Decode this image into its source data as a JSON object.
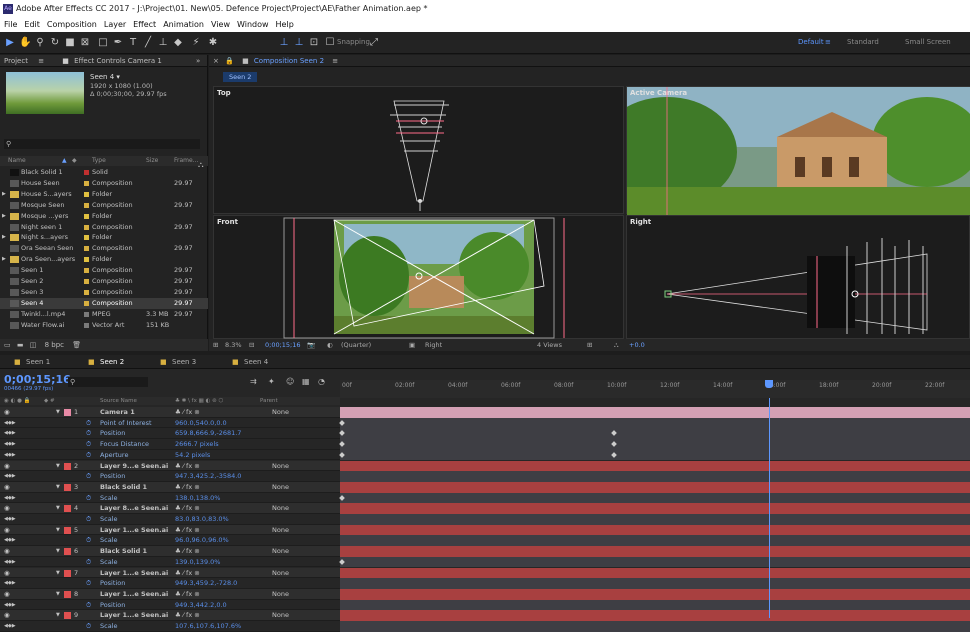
{
  "app": {
    "title": "Adobe After Effects CC 2017 - J:\\Project\\01. New\\05. Defence Project\\Project\\AE\\Father Animation.aep *",
    "icon": "Ae"
  },
  "menu": [
    "File",
    "Edit",
    "Composition",
    "Layer",
    "Effect",
    "Animation",
    "View",
    "Window",
    "Help"
  ],
  "toolbar": {
    "snapping": "Snapping",
    "workspaces": [
      "Default",
      "Standard",
      "Small Screen"
    ]
  },
  "project": {
    "tab": "Project",
    "effect_tab": "Effect Controls Camera 1",
    "selected": {
      "name": "Seen 4 ▾",
      "dims": "1920 x 1080 (1.00)",
      "duration": "Δ 0;00;30;00, 29.97 fps"
    },
    "columns": [
      "Name",
      "Type",
      "Size",
      "Frame..."
    ],
    "items": [
      {
        "name": "Black Solid 1",
        "type": "Solid",
        "size": "",
        "fps": "",
        "color": "#c03030"
      },
      {
        "name": "House Seen",
        "type": "Composition",
        "size": "",
        "fps": "29.97",
        "color": "#d8b040"
      },
      {
        "name": "House S...ayers",
        "type": "Folder",
        "size": "",
        "fps": "",
        "color": "#e0c040"
      },
      {
        "name": "Mosque Seen",
        "type": "Composition",
        "size": "",
        "fps": "29.97",
        "color": "#d8b040"
      },
      {
        "name": "Mosque ...yers",
        "type": "Folder",
        "size": "",
        "fps": "",
        "color": "#e0c040"
      },
      {
        "name": "Night seen 1",
        "type": "Composition",
        "size": "",
        "fps": "29.97",
        "color": "#d8b040"
      },
      {
        "name": "Night s...ayers",
        "type": "Folder",
        "size": "",
        "fps": "",
        "color": "#e0c040"
      },
      {
        "name": "Ora Seean Seen",
        "type": "Composition",
        "size": "",
        "fps": "29.97",
        "color": "#d8b040"
      },
      {
        "name": "Ora Seen...ayers",
        "type": "Folder",
        "size": "",
        "fps": "",
        "color": "#e0c040"
      },
      {
        "name": "Seen 1",
        "type": "Composition",
        "size": "",
        "fps": "29.97",
        "color": "#d8b040"
      },
      {
        "name": "Seen 2",
        "type": "Composition",
        "size": "",
        "fps": "29.97",
        "color": "#d8b040"
      },
      {
        "name": "Seen 3",
        "type": "Composition",
        "size": "",
        "fps": "29.97",
        "color": "#d8b040"
      },
      {
        "name": "Seen 4",
        "type": "Composition",
        "size": "",
        "fps": "29.97",
        "color": "#d8b040"
      },
      {
        "name": "Twinkl...l.mp4",
        "type": "MPEG",
        "size": "3.3 MB",
        "fps": "29.97",
        "color": "#7a7a7a"
      },
      {
        "name": "Water Flow.ai",
        "type": "Vector Art",
        "size": "151 KB",
        "fps": "",
        "color": "#7a7a7a"
      }
    ],
    "bpc": "8 bpc"
  },
  "composition": {
    "tab": "Composition Seen 2",
    "subtab": "Seen 2",
    "views": [
      "Top",
      "Active Camera",
      "Front",
      "Right"
    ],
    "footer": {
      "zoom": "8.3%",
      "time": "0;00;15;16",
      "res": "(Quarter)",
      "view": "Right",
      "layout": "4 Views",
      "exposure": "+0.0"
    }
  },
  "timeline": {
    "tabs": [
      "Seen 1",
      "Seen 2",
      "Seen 3",
      "Seen 4"
    ],
    "timecode": "0;00;15;16",
    "fps": "00466 (29.97 fps)",
    "header": {
      "source": "Source Name",
      "parent": "Parent"
    },
    "ruler": [
      "00f",
      "02:00f",
      "04:00f",
      "06:00f",
      "08:00f",
      "10:00f",
      "12:00f",
      "14:00f",
      "16:00f",
      "18:00f",
      "20:00f",
      "22:00f"
    ],
    "rows": [
      {
        "kind": "layer",
        "num": "1",
        "name": "Camera 1",
        "color": "#e88aa6",
        "parent": "None"
      },
      {
        "kind": "prop",
        "name": "Point of Interest",
        "value": "960.0,540.0,0.0"
      },
      {
        "kind": "prop",
        "name": "Position",
        "value": "659.8,666.9,-2681.7"
      },
      {
        "kind": "prop",
        "name": "Focus Distance",
        "value": "2666.7 pixels"
      },
      {
        "kind": "prop",
        "name": "Aperture",
        "value": "54.2 pixels"
      },
      {
        "kind": "layer",
        "num": "2",
        "name": "Layer 9...e Seen.ai",
        "color": "#e05050",
        "parent": "None"
      },
      {
        "kind": "prop",
        "name": "Position",
        "value": "947.3,425.2,-3584.0"
      },
      {
        "kind": "layer",
        "num": "3",
        "name": "Black Solid 1",
        "color": "#e05050",
        "parent": "None"
      },
      {
        "kind": "prop",
        "name": "Scale",
        "value": "138.0,138.0%"
      },
      {
        "kind": "layer",
        "num": "4",
        "name": "Layer 8...e Seen.ai",
        "color": "#e05050",
        "parent": "None"
      },
      {
        "kind": "prop",
        "name": "Scale",
        "value": "83.0,83.0,83.0%"
      },
      {
        "kind": "layer",
        "num": "5",
        "name": "Layer 1...e Seen.ai",
        "color": "#e05050",
        "parent": "None"
      },
      {
        "kind": "prop",
        "name": "Scale",
        "value": "96.0,96.0,96.0%"
      },
      {
        "kind": "layer",
        "num": "6",
        "name": "Black Solid 1",
        "color": "#e05050",
        "parent": "None"
      },
      {
        "kind": "prop",
        "name": "Scale",
        "value": "139.0,139.0%"
      },
      {
        "kind": "layer",
        "num": "7",
        "name": "Layer 1...e Seen.ai",
        "color": "#e05050",
        "parent": "None"
      },
      {
        "kind": "prop",
        "name": "Position",
        "value": "949.3,459.2,-728.0"
      },
      {
        "kind": "layer",
        "num": "8",
        "name": "Layer 1...e Seen.ai",
        "color": "#e05050",
        "parent": "None"
      },
      {
        "kind": "prop",
        "name": "Position",
        "value": "949.3,442.2,0.0"
      },
      {
        "kind": "layer",
        "num": "9",
        "name": "Layer 1...e Seen.ai",
        "color": "#e05050",
        "parent": "None"
      },
      {
        "kind": "prop",
        "name": "Scale",
        "value": "107.6,107.6,107.6%"
      }
    ]
  }
}
